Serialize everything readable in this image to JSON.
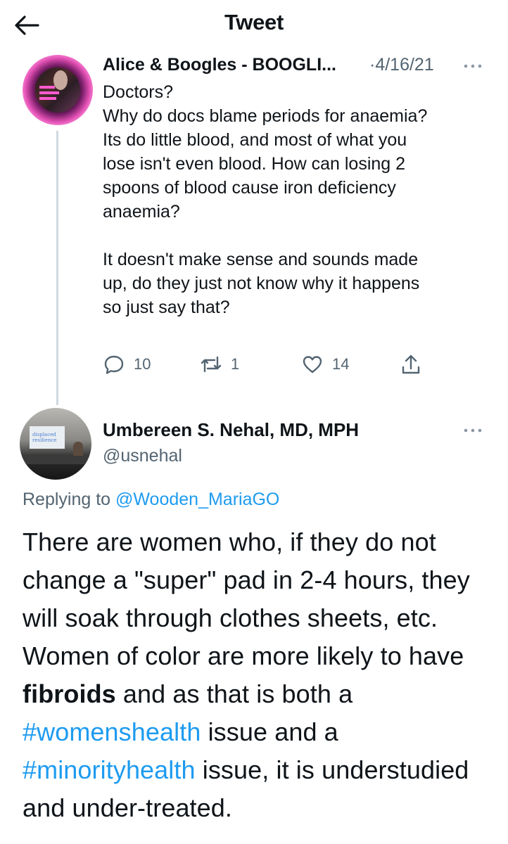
{
  "header": {
    "title": "Tweet",
    "back_icon": "arrow-left-icon"
  },
  "tweet1": {
    "author_name": "Alice & Boogles - BOOGLI...",
    "date": "·4/16/21",
    "lines": [
      "Doctors?",
      "Why do docs blame periods for anaemia?",
      "Its do little blood, and most of what you",
      "lose isn't even blood. How can losing 2",
      "spoons of blood cause iron deficiency",
      "anaemia?"
    ],
    "lines2": [
      "It doesn't make sense and sounds made",
      "up, do they just not know why it happens",
      "so just say that?"
    ],
    "actions": {
      "replies": "10",
      "retweets": "1",
      "likes": "14"
    }
  },
  "tweet2": {
    "author_name": "Umbereen S. Nehal, MD, MPH",
    "handle": "@usnehal",
    "replying_prefix": "Replying to",
    "replying_handle": "@Wooden_MariaGO",
    "body": {
      "p1": "There are women who, if they do not change a \"super\" pad in 2-4 hours, they will soak through clothes sheets, etc. Women of color are more likely to have ",
      "bold": "fibroids",
      "p2": " and as that is both a ",
      "hashtag1": "#womenshealth",
      "p3": " issue and a ",
      "hashtag2": "#minorityhealth",
      "p4": " issue, it is understudied and under-treated."
    },
    "avatar_slide_text": "displaced resilience"
  },
  "colors": {
    "link": "#1d9bf0",
    "secondary": "#536471",
    "text": "#0f1419"
  }
}
